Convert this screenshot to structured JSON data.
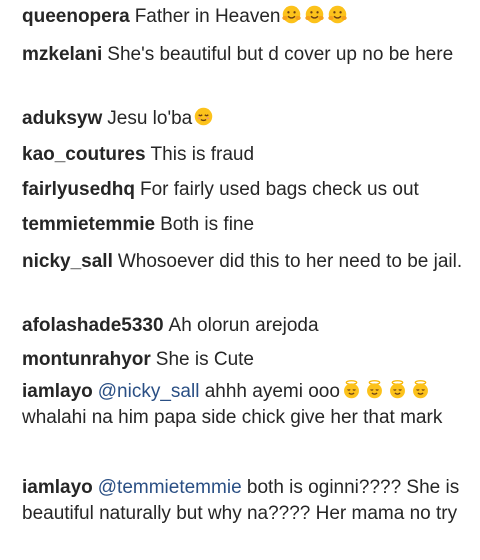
{
  "comments": [
    {
      "user": "queenopera",
      "text": "Father in Heaven",
      "emoji": [
        "hugging-face-icon",
        "hugging-face-icon",
        "hugging-face-icon"
      ]
    },
    {
      "user": "mzkelani",
      "text": "She's beautiful but d cover up no be here"
    },
    {
      "user": "aduksyw",
      "text": "Jesu lo'ba",
      "emoji": [
        "relieved-face-icon"
      ]
    },
    {
      "user": "kao_coutures",
      "text": "This is fraud"
    },
    {
      "user": "fairlyusedhq",
      "text": "For fairly used bags check us out"
    },
    {
      "user": "temmietemmie",
      "text": "Both is fine"
    },
    {
      "user": "nicky_sall",
      "text": "Whosoever did this to her need to be jail."
    },
    {
      "user": "afolashade5330",
      "text": "Ah olorun arejoda"
    },
    {
      "user": "montunrahyor",
      "text": "She is Cute"
    },
    {
      "user": "iamlayo",
      "mention": "@nicky_sall",
      "text": "ahhh ayemi ooo",
      "emoji": [
        "angel-face-icon",
        "angel-face-icon",
        "angel-face-icon",
        "angel-face-icon"
      ],
      "text2": "whalahi na him papa side chick give her that mark"
    },
    {
      "user": "iamlayo",
      "mention": "@temmietemmie",
      "text": "both is oginni???? She is beautiful naturally but why na???? Her mama no try"
    }
  ],
  "colors": {
    "username": "#262626",
    "text": "#262626",
    "mention": "#2a4f84",
    "emoji": "#fcc21b"
  }
}
